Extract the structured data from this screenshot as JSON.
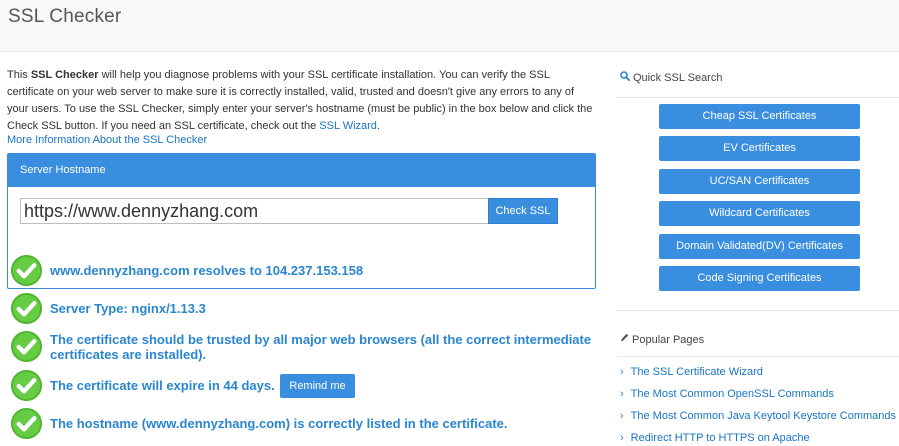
{
  "header": {
    "title": "SSL Checker"
  },
  "intro": {
    "prefix": "This ",
    "bold": "SSL Checker",
    "body": " will help you diagnose problems with your SSL certificate installation. You can verify the SSL certificate on your web server to make sure it is correctly installed, valid, trusted and doesn't give any errors to any of your users. To use the SSL Checker, simply enter your server's hostname (must be public) in the box below and click the Check SSL button. If you need an SSL certificate, check out the ",
    "link": "SSL Wizard",
    "suffix": "."
  },
  "more_info_link": "More Information About the SSL Checker",
  "form": {
    "panel_title": "Server Hostname",
    "hostname_value": "https://www.dennyzhang.com",
    "check_button": "Check SSL"
  },
  "results": [
    {
      "text": "www.dennyzhang.com resolves to 104.237.153.158"
    },
    {
      "text": "Server Type: nginx/1.13.3"
    },
    {
      "text": "The certificate should be trusted by all major web browsers (all the correct intermediate certificates are installed)."
    },
    {
      "text": "The certificate will expire in 44 days."
    },
    {
      "text": "The hostname (www.dennyzhang.com) is correctly listed in the certificate."
    }
  ],
  "remind_button": "Remind me",
  "sidebar": {
    "quick_search_title": "Quick SSL Search",
    "buttons": [
      "Cheap SSL Certificates",
      "EV Certificates",
      "UC/SAN Certificates",
      "Wildcard Certificates",
      "Domain Validated(DV) Certificates",
      "Code Signing Certificates"
    ],
    "popular_title": "Popular Pages",
    "links": [
      "The SSL Certificate Wizard",
      "The Most Common OpenSSL Commands",
      "The Most Common Java Keytool Keystore Commands",
      "Redirect HTTP to HTTPS on Apache"
    ]
  },
  "colors": {
    "accent": "#3a8ee0",
    "link": "#1a75c4",
    "success": "#5cc33b"
  },
  "icons": {
    "search": "search-icon",
    "popular": "pencil-icon",
    "result": "check-icon",
    "link_arrow": "chevron-right-icon"
  }
}
